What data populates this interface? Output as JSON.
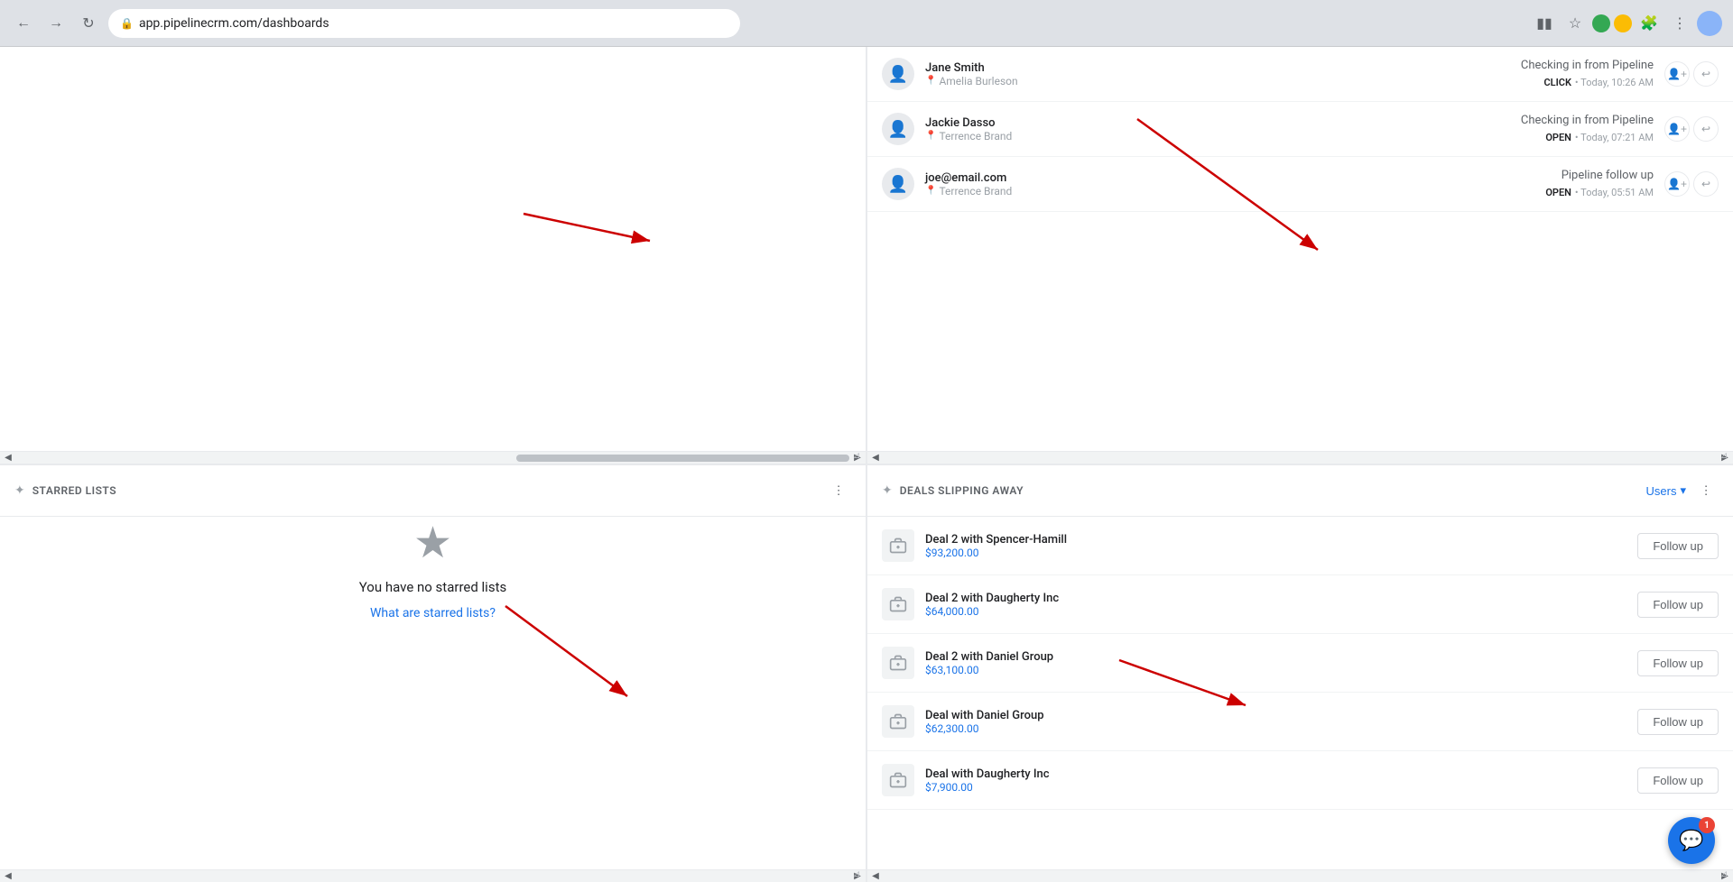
{
  "browser": {
    "url": "app.pipelinecrm.com/dashboards",
    "back_btn": "←",
    "forward_btn": "→",
    "reload_btn": "↻"
  },
  "panels": {
    "top_left": {
      "content": "email_activity_partial"
    },
    "top_right": {
      "emails": [
        {
          "name": "Jane Smith",
          "sub_agent": "Amelia Burleson",
          "subject": "Checking in from Pipeline",
          "status": "CLICK",
          "time": "Today, 10:26 AM"
        },
        {
          "name": "Jackie Dasso",
          "sub_agent": "Terrence Brand",
          "subject": "Checking in from Pipeline",
          "status": "OPEN",
          "time": "Today, 07:21 AM"
        },
        {
          "name": "joe@email.com",
          "sub_agent": "Terrence Brand",
          "subject": "Pipeline follow up",
          "status": "OPEN",
          "time": "Today, 05:51 AM"
        }
      ]
    },
    "bottom_left": {
      "title": "STARRED LISTS",
      "empty_text": "You have no starred lists",
      "empty_link": "What are starred lists?"
    },
    "bottom_right": {
      "title": "DEALS SLIPPING AWAY",
      "users_label": "Users",
      "deals": [
        {
          "name": "Deal 2 with Spencer-Hamill",
          "amount": "$93,200.00",
          "follow_up_label": "Follow up"
        },
        {
          "name": "Deal 2 with Daugherty Inc",
          "amount": "$64,000.00",
          "follow_up_label": "Follow up"
        },
        {
          "name": "Deal 2 with Daniel Group",
          "amount": "$63,100.00",
          "follow_up_label": "Follow up"
        },
        {
          "name": "Deal with Daniel Group",
          "amount": "$62,300.00",
          "follow_up_label": "Follow up"
        },
        {
          "name": "Deal with Daugherty Inc",
          "amount": "$7,900.00",
          "follow_up_label": "Follow up"
        }
      ]
    }
  },
  "chat": {
    "badge": "1"
  }
}
